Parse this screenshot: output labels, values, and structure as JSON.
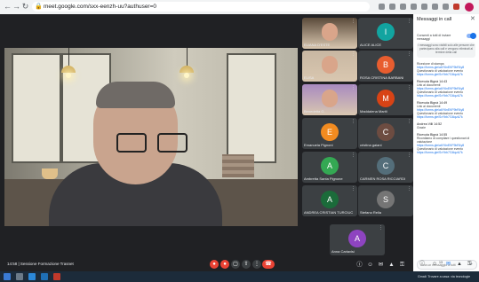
{
  "browser": {
    "url": "meet.google.com/sxx-eenzh-uu?authuser=0"
  },
  "main_video": {},
  "participants": [
    {
      "name": "ELIANA D'ESTE",
      "initial": "",
      "color": "#5a4a3a",
      "type": "photo"
    },
    {
      "name": "ALICE ALICE",
      "initial": "I",
      "color": "#12a4a0",
      "type": "avatar"
    },
    {
      "name": "ELISA",
      "initial": "",
      "color": "#c8b7a2",
      "type": "photo"
    },
    {
      "name": "ROSA CRISTINA BARBANI",
      "initial": "B",
      "color": "#e85d2f",
      "type": "avatar"
    },
    {
      "name": "Benedetta G.",
      "initial": "",
      "color": "#a88ac0",
      "type": "photo"
    },
    {
      "name": "Maddalena Mariti",
      "initial": "M",
      "color": "#d84315",
      "type": "avatar"
    },
    {
      "name": "Emanuela Pignoni",
      "initial": "E",
      "color": "#f28b20",
      "type": "avatar"
    },
    {
      "name": "cristina gaiani",
      "initial": "C",
      "color": "#6d4c41",
      "type": "avatar"
    },
    {
      "name": "Ambretta Santa Pignone",
      "initial": "A",
      "color": "#34a853",
      "type": "avatar"
    },
    {
      "name": "CARMEN ROSA RICCIARDI",
      "initial": "C",
      "color": "#546e7a",
      "type": "avatar"
    },
    {
      "name": "ANDREA CRISTIAN TURCIUC",
      "initial": "A",
      "color": "#1b6b3a",
      "type": "avatar"
    },
    {
      "name": "Stefano Rella",
      "initial": "S",
      "color": "#757575",
      "type": "avatar"
    },
    {
      "name": "Anna Carlavisi",
      "initial": "A",
      "color": "#8e44c0",
      "type": "avatar"
    }
  ],
  "chat": {
    "title": "Messaggi in call",
    "close_icon": "✕",
    "toggle_label": "Consenti a tutti di inviare messaggi",
    "notice": "I messaggi sono visibili solo alle persone che partecipano alla call e vengono eliminati al termine della call",
    "messages": [
      {
        "sender": "",
        "lines": [
          {
            "kind": "text",
            "text": "Ricezione di stampa"
          },
          {
            "kind": "link",
            "text": "https://forms.gle/a6Y6nEKF9bR4y8"
          },
          {
            "kind": "text",
            "text": "Questionario di valutazione evento"
          },
          {
            "kind": "link",
            "text": "https://forms.gle/SxYbb7G4iqzA7k"
          }
        ]
      },
      {
        "sender": "Ricevuta Bignà   14:43",
        "lines": [
          {
            "kind": "text",
            "text": "Link ai documenti"
          },
          {
            "kind": "link",
            "text": "https://forms.gle/a6Y6nEKF9bR4y8"
          },
          {
            "kind": "text",
            "text": "Questionario di valutazione evento"
          },
          {
            "kind": "link",
            "text": "https://forms.gle/SxYbb7G4iqzA7k"
          }
        ]
      },
      {
        "sender": "Ricevuta Bignà   14:49",
        "lines": [
          {
            "kind": "text",
            "text": "Link ai documenti"
          },
          {
            "kind": "link",
            "text": "https://forms.gle/a6Y6nEKF9bR4y8"
          },
          {
            "kind": "text",
            "text": "Questionario di valutazione evento"
          },
          {
            "kind": "link",
            "text": "https://forms.gle/SxYbb7G4iqzA7k"
          }
        ]
      },
      {
        "sender": "Andrea Villi   14:52",
        "lines": [
          {
            "kind": "text",
            "text": "Grazie"
          }
        ]
      },
      {
        "sender": "Ricevuta Bignà   14:55",
        "lines": [
          {
            "kind": "text",
            "text": "Ricordiamo di compilare i questionari di valutazione"
          },
          {
            "kind": "link",
            "text": "https://forms.gle/a6Y6nEKF9bR4y8"
          },
          {
            "kind": "text",
            "text": "Questionario di valutazione evento"
          },
          {
            "kind": "link",
            "text": "https://forms.gle/SxYbb7G4iqzA7k"
          }
        ]
      }
    ],
    "input_placeholder": "Invia un messaggio a tutti",
    "send_icon": "➤"
  },
  "controls": {
    "meeting_time": "14:58  |  Sessione Formazione Trasnet",
    "mic_icon": "●",
    "camera_icon": "●",
    "captions_icon": "▢",
    "present_icon": "⇧",
    "more_icon": "⋮",
    "end_call_icon": "☎",
    "info_icon": "ⓘ",
    "people_icon": "☺",
    "chat_icon": "✉",
    "activities_icon": "▲",
    "lock_icon": "⚿",
    "people_count": "13",
    "colors": {
      "mic": "#ea4335",
      "camera": "#ea4335",
      "end_call": "#ea4335",
      "neutral": "#3c4043"
    }
  },
  "taskbar": {
    "tray_text": "Gmail: Trovare a casa: via tecnologie"
  }
}
